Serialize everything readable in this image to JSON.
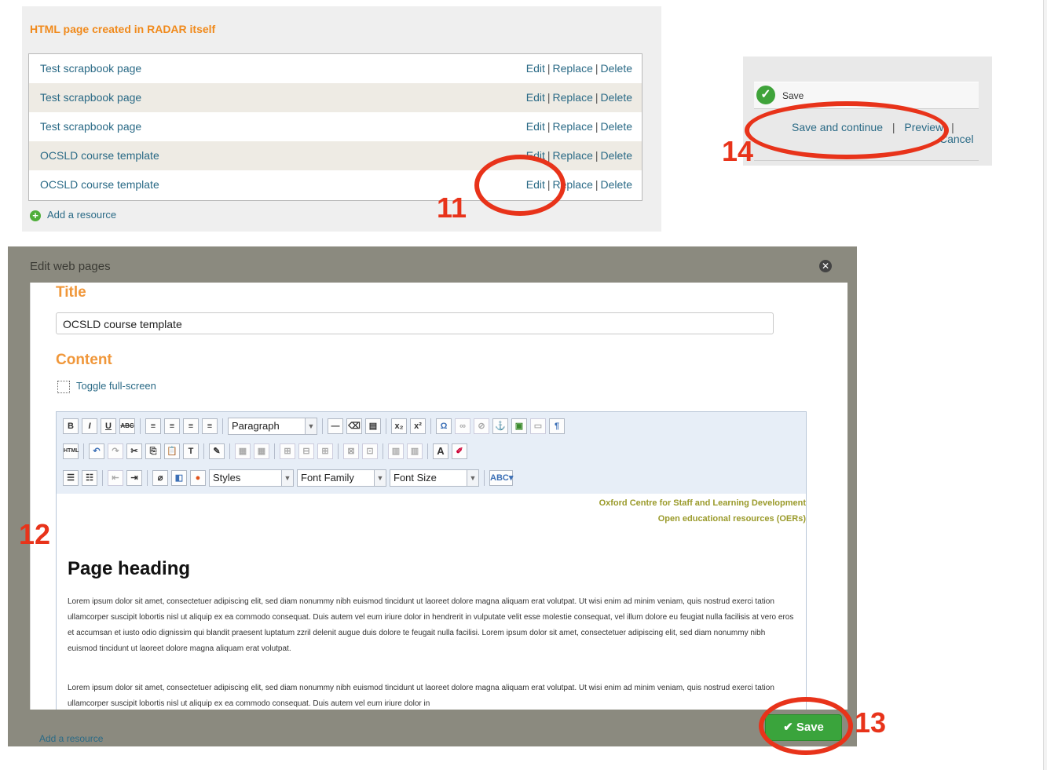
{
  "resources": {
    "heading": "HTML page created in RADAR itself",
    "rows": [
      {
        "name": "Test scrapbook page",
        "edit": "Edit",
        "replace": "Replace",
        "delete": "Delete"
      },
      {
        "name": "Test scrapbook page",
        "edit": "Edit",
        "replace": "Replace",
        "delete": "Delete"
      },
      {
        "name": "Test scrapbook page",
        "edit": "Edit",
        "replace": "Replace",
        "delete": "Delete"
      },
      {
        "name": "OCSLD course template",
        "edit": "Edit",
        "replace": "Replace",
        "delete": "Delete"
      },
      {
        "name": "OCSLD course template",
        "edit": "Edit",
        "replace": "Replace",
        "delete": "Delete"
      }
    ],
    "add_label": "Add a resource",
    "sep": "|"
  },
  "save_panel": {
    "save_label": "Save",
    "save_continue": "Save and continue",
    "preview": "Preview",
    "cancel": "Cancel",
    "sep": "|"
  },
  "dialog": {
    "title": "Edit web pages",
    "close_glyph": "✕",
    "title_label": "Title",
    "title_value": "OCSLD course template",
    "content_label": "Content",
    "toggle_label": "Toggle full-screen",
    "toolbar": {
      "format_value": "Paragraph",
      "styles_value": "Styles",
      "font_family_value": "Font Family",
      "font_size_value": "Font Size"
    },
    "document": {
      "org_line1": "Oxford Centre for Staff and Learning Development",
      "org_line2": "Open educational resources (OERs)",
      "heading": "Page heading",
      "para1": "Lorem ipsum dolor sit amet, consectetuer adipiscing elit, sed diam nonummy nibh euismod tincidunt ut laoreet dolore magna aliquam erat volutpat. Ut wisi enim ad minim veniam, quis nostrud exerci tation ullamcorper suscipit lobortis nisl ut aliquip ex ea commodo consequat. Duis autem vel eum iriure dolor in hendrerit in vulputate velit esse molestie consequat, vel illum dolore eu feugiat nulla facilisis at vero eros et accumsan et iusto odio dignissim qui blandit praesent luptatum zzril delenit augue duis dolore te feugait nulla facilisi. Lorem ipsum dolor sit amet, consectetuer adipiscing elit, sed diam nonummy nibh euismod tincidunt ut laoreet dolore magna aliquam erat volutpat.",
      "para2": "Lorem ipsum dolor sit amet, consectetuer adipiscing elit, sed diam nonummy nibh euismod tincidunt ut laoreet dolore magna aliquam erat volutpat. Ut wisi enim ad minim veniam, quis nostrud exerci tation ullamcorper suscipit lobortis nisl ut aliquip ex ea commodo consequat. Duis autem vel eum iriure dolor in"
    },
    "save_button": "✔ Save"
  },
  "behind_text": "Add a resource",
  "annotations": {
    "n11": "11",
    "n12": "12",
    "n13": "13",
    "n14": "14"
  },
  "colors": {
    "accent_orange": "#f08a1c",
    "link_blue": "#2a6a86",
    "annotation_red": "#e8331a",
    "save_green": "#3aa43c"
  }
}
